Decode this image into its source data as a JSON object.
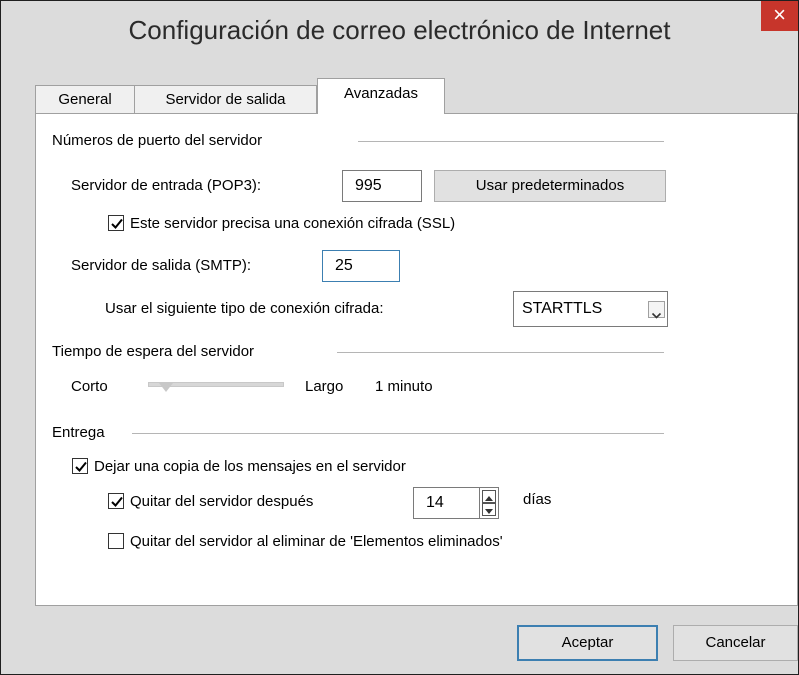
{
  "window": {
    "title": "Configuración de correo electrónico de Internet",
    "close_label": "×"
  },
  "tabs": [
    {
      "label": "General",
      "active": false
    },
    {
      "label": "Servidor de salida",
      "active": false
    },
    {
      "label": "Avanzadas",
      "active": true
    }
  ],
  "ports": {
    "group_label": "Números de puerto del servidor",
    "incoming_label": "Servidor de entrada (POP3):",
    "incoming_value": "995",
    "defaults_button": "Usar predeterminados",
    "ssl_label": "Este servidor precisa una conexión cifrada (SSL)",
    "ssl_checked": true,
    "outgoing_label": "Servidor de salida (SMTP):",
    "outgoing_value": "25",
    "encryption_label": "Usar el siguiente tipo de conexión cifrada:",
    "encryption_value": "STARTTLS"
  },
  "timeout": {
    "group_label": "Tiempo de espera del servidor",
    "short_label": "Corto",
    "long_label": "Largo",
    "value_label": "1 minuto",
    "slider_level": 0.1
  },
  "delivery": {
    "group_label": "Entrega",
    "leave_copy_label": "Dejar una copia de los mensajes en el servidor",
    "leave_copy_checked": true,
    "remove_after_label": "Quitar del servidor después",
    "remove_after_checked": true,
    "days_value": "14",
    "days_label": "días",
    "remove_deleted_label": "Quitar del servidor al eliminar de 'Elementos eliminados'",
    "remove_deleted_checked": false
  },
  "footer": {
    "ok_label": "Aceptar",
    "cancel_label": "Cancelar"
  }
}
